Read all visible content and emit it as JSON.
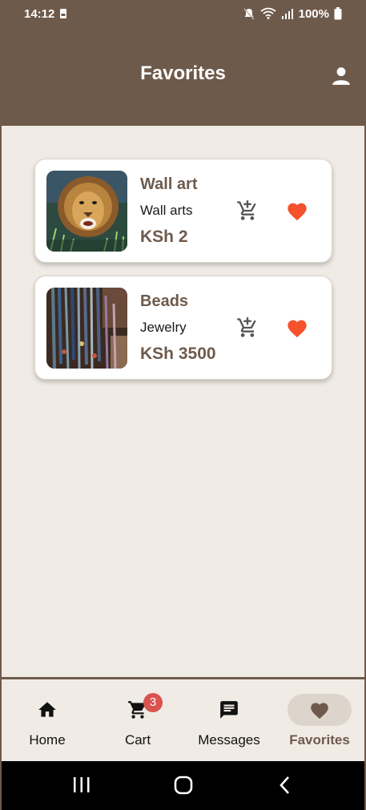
{
  "status_bar": {
    "time": "14:12",
    "battery_percent": "100%",
    "icons": [
      "storage-icon",
      "mute-icon",
      "wifi-icon",
      "signal-icon",
      "battery-icon"
    ]
  },
  "header": {
    "title": "Favorites",
    "profile_icon": "person-icon"
  },
  "favorites": [
    {
      "name": "Wall art",
      "category": "Wall arts",
      "price": "KSh 2",
      "image": "lion-painting",
      "favorited": true
    },
    {
      "name": "Beads",
      "category": "Jewelry",
      "price": "KSh 3500",
      "image": "beaded-jewelry",
      "favorited": true
    }
  ],
  "bottom_nav": {
    "items": [
      {
        "label": "Home",
        "icon": "home-icon",
        "active": false
      },
      {
        "label": "Cart",
        "icon": "cart-icon",
        "badge": "3",
        "active": false
      },
      {
        "label": "Messages",
        "icon": "message-icon",
        "active": false
      },
      {
        "label": "Favorites",
        "icon": "heart-icon",
        "active": true
      }
    ]
  },
  "system_nav": [
    "recents-icon",
    "home-circle-icon",
    "back-icon"
  ],
  "colors": {
    "primary": "#6e5a4b",
    "background": "#f0ebe4",
    "heart": "#f4512c",
    "badge": "#d9534f"
  }
}
